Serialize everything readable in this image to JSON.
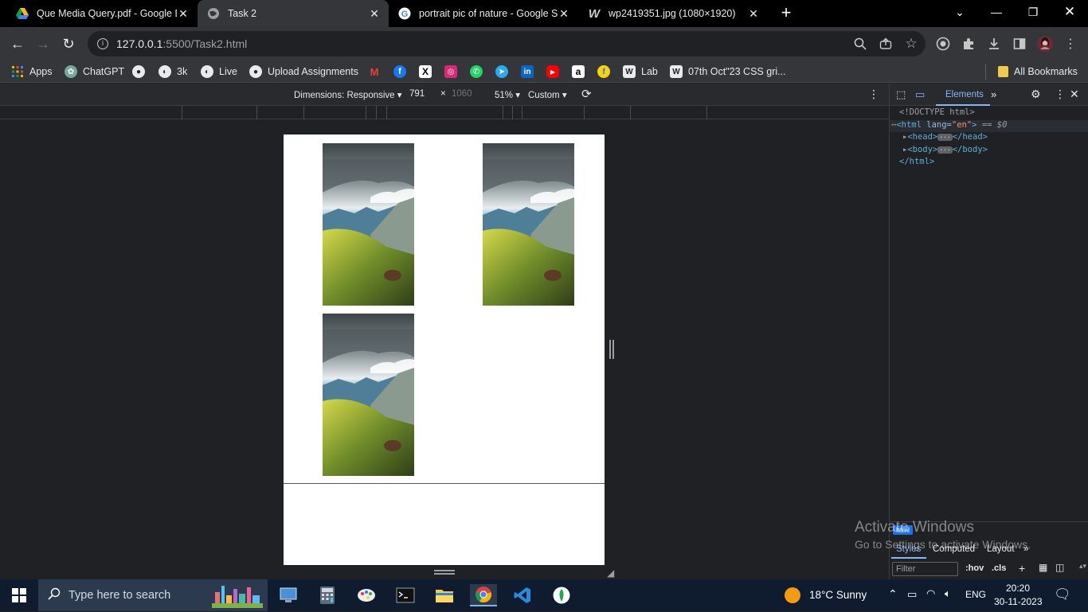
{
  "tabs": [
    {
      "title": "Que Media Query.pdf - Google D",
      "icon": "google-drive-icon"
    },
    {
      "title": "Task 2",
      "icon": "globe-icon",
      "active": true
    },
    {
      "title": "portrait pic of nature - Google S",
      "icon": "google-icon"
    },
    {
      "title": "wp2419351.jpg (1080×1920)",
      "icon": "wallpaper-w-icon"
    }
  ],
  "address": {
    "host": "127.0.0.1",
    "path": ":5500/Task2.html"
  },
  "bookmarks": [
    {
      "label": "Apps",
      "icon": "apps-grid-icon"
    },
    {
      "label": "ChatGPT",
      "icon": "chatgpt-icon"
    },
    {
      "label": "",
      "icon": "github-icon"
    },
    {
      "label": "3k",
      "icon": "globe-icon"
    },
    {
      "label": "Live",
      "icon": "globe-icon"
    },
    {
      "label": "Upload Assignments",
      "icon": "github-icon"
    },
    {
      "label": "Lab",
      "icon": "wordpress-icon"
    },
    {
      "label": "07th Oct\"23 CSS gri...",
      "icon": "wordpress-icon"
    }
  ],
  "all_bookmarks_label": "All Bookmarks",
  "device_toolbar": {
    "dimensions_label": "Dimensions: Responsive",
    "width": "791",
    "times": "×",
    "height": "1060",
    "zoom": "51%",
    "throttle": "Custom"
  },
  "devtools": {
    "active_tab": "Elements",
    "dom": {
      "doctype": "<!DOCTYPE html>",
      "html_open": "<html",
      "lang_attr": " lang=",
      "lang_val": "\"en\"",
      "html_close_bracket": ">",
      "selected_marker": " == $0",
      "head_open": "<head>",
      "head_close": "</head>",
      "body_open": "<body>",
      "body_close": "</body>",
      "html_end": "</html>"
    },
    "styles_tabs": [
      "Styles",
      "Computed",
      "Layout"
    ],
    "html_badge": "html",
    "filter_placeholder": "Filter",
    "hov": ":hov",
    "cls": ".cls"
  },
  "watermark": {
    "line1": "Activate Windows",
    "line2": "Go to Settings to activate Windows."
  },
  "taskbar": {
    "search_placeholder": "Type here to search",
    "weather": "18°C  Sunny",
    "language": "ENG",
    "time": "20:20",
    "date": "30-11-2023"
  }
}
